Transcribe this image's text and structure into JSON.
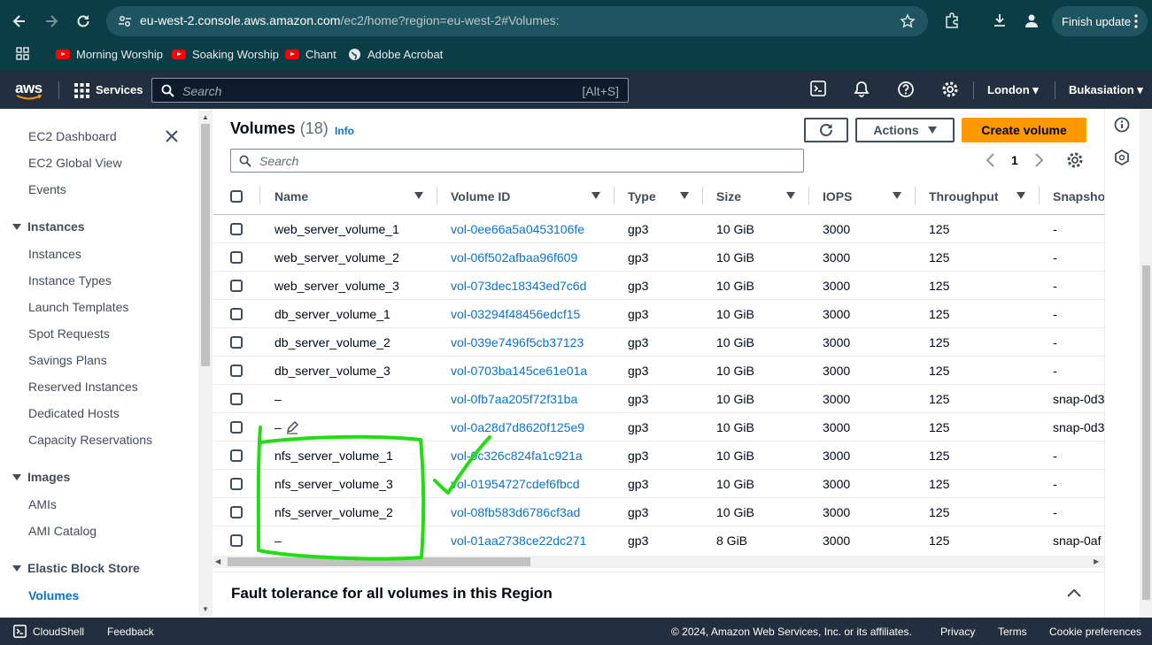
{
  "browser": {
    "url_host": "eu-west-2.console.aws.amazon.com",
    "url_rest": "/ec2/home?region=eu-west-2#Volumes:",
    "finish_update": "Finish update",
    "bookmarks": [
      "Morning Worship",
      "Soaking Worship",
      "Chant",
      "Adobe Acrobat"
    ]
  },
  "aws_header": {
    "logo": "aws",
    "services": "Services",
    "search_placeholder": "Search",
    "search_shortcut": "[Alt+S]",
    "region": "London",
    "account": "Bukasiation"
  },
  "sidebar": {
    "top_items": [
      "EC2 Dashboard",
      "EC2 Global View",
      "Events"
    ],
    "instances_header": "Instances",
    "instances_items": [
      "Instances",
      "Instance Types",
      "Launch Templates",
      "Spot Requests",
      "Savings Plans",
      "Reserved Instances",
      "Dedicated Hosts",
      "Capacity Reservations"
    ],
    "images_header": "Images",
    "images_items": [
      "AMIs",
      "AMI Catalog"
    ],
    "ebs_header": "Elastic Block Store",
    "ebs_active": "Volumes"
  },
  "main": {
    "title": "Volumes",
    "count": "(18)",
    "info": "Info",
    "actions": "Actions",
    "create": "Create volume",
    "search_placeholder": "Search",
    "page": "1",
    "columns": [
      "Name",
      "Volume ID",
      "Type",
      "Size",
      "IOPS",
      "Throughput",
      "Snapshot"
    ],
    "rows": [
      {
        "name": "web_server_volume_1",
        "id": "vol-0ee66a5a0453106fe",
        "type": "gp3",
        "size": "10 GiB",
        "iops": "3000",
        "throughput": "125",
        "snapshot": "-"
      },
      {
        "name": "web_server_volume_2",
        "id": "vol-06f502afbaa96f609",
        "type": "gp3",
        "size": "10 GiB",
        "iops": "3000",
        "throughput": "125",
        "snapshot": "-"
      },
      {
        "name": "web_server_volume_3",
        "id": "vol-073dec18343ed7c6d",
        "type": "gp3",
        "size": "10 GiB",
        "iops": "3000",
        "throughput": "125",
        "snapshot": "-"
      },
      {
        "name": "db_server_volume_1",
        "id": "vol-03294f48456edcf15",
        "type": "gp3",
        "size": "10 GiB",
        "iops": "3000",
        "throughput": "125",
        "snapshot": "-"
      },
      {
        "name": "db_server_volume_2",
        "id": "vol-039e7496f5cb37123",
        "type": "gp3",
        "size": "10 GiB",
        "iops": "3000",
        "throughput": "125",
        "snapshot": "-"
      },
      {
        "name": "db_server_volume_3",
        "id": "vol-0703ba145ce61e01a",
        "type": "gp3",
        "size": "10 GiB",
        "iops": "3000",
        "throughput": "125",
        "snapshot": "-"
      },
      {
        "name": "–",
        "id": "vol-0fb7aa205f72f31ba",
        "type": "gp3",
        "size": "10 GiB",
        "iops": "3000",
        "throughput": "125",
        "snapshot": "snap-0d3"
      },
      {
        "name": "–",
        "id": "vol-0a28d7d8620f125e9",
        "type": "gp3",
        "size": "10 GiB",
        "iops": "3000",
        "throughput": "125",
        "snapshot": "snap-0d3"
      },
      {
        "name": "nfs_server_volume_1",
        "id": "vol-0c326c824fa1c921a",
        "type": "gp3",
        "size": "10 GiB",
        "iops": "3000",
        "throughput": "125",
        "snapshot": "-"
      },
      {
        "name": "nfs_server_volume_3",
        "id": "vol-01954727cdef6fbcd",
        "type": "gp3",
        "size": "10 GiB",
        "iops": "3000",
        "throughput": "125",
        "snapshot": "-"
      },
      {
        "name": "nfs_server_volume_2",
        "id": "vol-08fb583d6786cf3ad",
        "type": "gp3",
        "size": "10 GiB",
        "iops": "3000",
        "throughput": "125",
        "snapshot": "-"
      },
      {
        "name": "–",
        "id": "vol-01aa2738ce22dc271",
        "type": "gp3",
        "size": "8 GiB",
        "iops": "3000",
        "throughput": "125",
        "snapshot": "snap-0af"
      }
    ],
    "fault_panel": "Fault tolerance for all volumes in this Region"
  },
  "footer": {
    "cloudshell": "CloudShell",
    "feedback": "Feedback",
    "copyright": "© 2024, Amazon Web Services, Inc. or its affiliates.",
    "privacy": "Privacy",
    "terms": "Terms",
    "cookies": "Cookie preferences"
  },
  "colors": {
    "browser_bg": "#0b3d47",
    "aws_header": "#232f3e",
    "link": "#0972d3",
    "primary_button": "#ff9900",
    "annotation": "#22dd11"
  }
}
